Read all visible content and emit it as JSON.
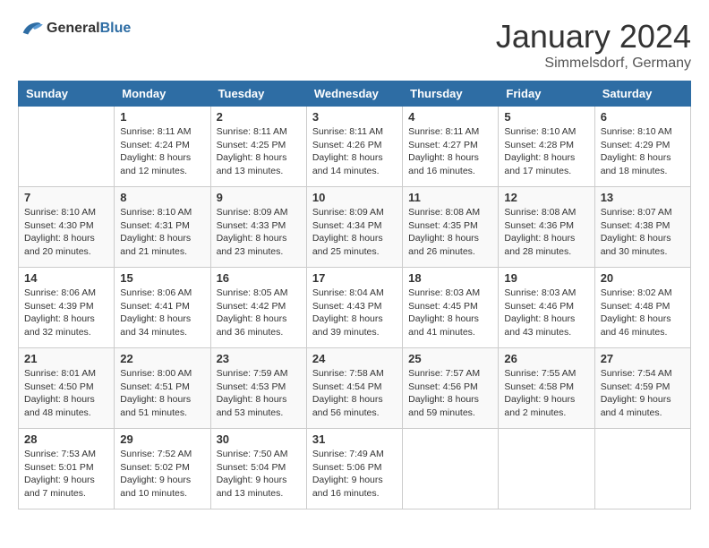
{
  "header": {
    "logo_general": "General",
    "logo_blue": "Blue",
    "title": "January 2024",
    "location": "Simmelsdorf, Germany"
  },
  "days_of_week": [
    "Sunday",
    "Monday",
    "Tuesday",
    "Wednesday",
    "Thursday",
    "Friday",
    "Saturday"
  ],
  "weeks": [
    [
      {
        "num": "",
        "info": ""
      },
      {
        "num": "1",
        "info": "Sunrise: 8:11 AM\nSunset: 4:24 PM\nDaylight: 8 hours\nand 12 minutes."
      },
      {
        "num": "2",
        "info": "Sunrise: 8:11 AM\nSunset: 4:25 PM\nDaylight: 8 hours\nand 13 minutes."
      },
      {
        "num": "3",
        "info": "Sunrise: 8:11 AM\nSunset: 4:26 PM\nDaylight: 8 hours\nand 14 minutes."
      },
      {
        "num": "4",
        "info": "Sunrise: 8:11 AM\nSunset: 4:27 PM\nDaylight: 8 hours\nand 16 minutes."
      },
      {
        "num": "5",
        "info": "Sunrise: 8:10 AM\nSunset: 4:28 PM\nDaylight: 8 hours\nand 17 minutes."
      },
      {
        "num": "6",
        "info": "Sunrise: 8:10 AM\nSunset: 4:29 PM\nDaylight: 8 hours\nand 18 minutes."
      }
    ],
    [
      {
        "num": "7",
        "info": "Sunrise: 8:10 AM\nSunset: 4:30 PM\nDaylight: 8 hours\nand 20 minutes."
      },
      {
        "num": "8",
        "info": "Sunrise: 8:10 AM\nSunset: 4:31 PM\nDaylight: 8 hours\nand 21 minutes."
      },
      {
        "num": "9",
        "info": "Sunrise: 8:09 AM\nSunset: 4:33 PM\nDaylight: 8 hours\nand 23 minutes."
      },
      {
        "num": "10",
        "info": "Sunrise: 8:09 AM\nSunset: 4:34 PM\nDaylight: 8 hours\nand 25 minutes."
      },
      {
        "num": "11",
        "info": "Sunrise: 8:08 AM\nSunset: 4:35 PM\nDaylight: 8 hours\nand 26 minutes."
      },
      {
        "num": "12",
        "info": "Sunrise: 8:08 AM\nSunset: 4:36 PM\nDaylight: 8 hours\nand 28 minutes."
      },
      {
        "num": "13",
        "info": "Sunrise: 8:07 AM\nSunset: 4:38 PM\nDaylight: 8 hours\nand 30 minutes."
      }
    ],
    [
      {
        "num": "14",
        "info": "Sunrise: 8:06 AM\nSunset: 4:39 PM\nDaylight: 8 hours\nand 32 minutes."
      },
      {
        "num": "15",
        "info": "Sunrise: 8:06 AM\nSunset: 4:41 PM\nDaylight: 8 hours\nand 34 minutes."
      },
      {
        "num": "16",
        "info": "Sunrise: 8:05 AM\nSunset: 4:42 PM\nDaylight: 8 hours\nand 36 minutes."
      },
      {
        "num": "17",
        "info": "Sunrise: 8:04 AM\nSunset: 4:43 PM\nDaylight: 8 hours\nand 39 minutes."
      },
      {
        "num": "18",
        "info": "Sunrise: 8:03 AM\nSunset: 4:45 PM\nDaylight: 8 hours\nand 41 minutes."
      },
      {
        "num": "19",
        "info": "Sunrise: 8:03 AM\nSunset: 4:46 PM\nDaylight: 8 hours\nand 43 minutes."
      },
      {
        "num": "20",
        "info": "Sunrise: 8:02 AM\nSunset: 4:48 PM\nDaylight: 8 hours\nand 46 minutes."
      }
    ],
    [
      {
        "num": "21",
        "info": "Sunrise: 8:01 AM\nSunset: 4:50 PM\nDaylight: 8 hours\nand 48 minutes."
      },
      {
        "num": "22",
        "info": "Sunrise: 8:00 AM\nSunset: 4:51 PM\nDaylight: 8 hours\nand 51 minutes."
      },
      {
        "num": "23",
        "info": "Sunrise: 7:59 AM\nSunset: 4:53 PM\nDaylight: 8 hours\nand 53 minutes."
      },
      {
        "num": "24",
        "info": "Sunrise: 7:58 AM\nSunset: 4:54 PM\nDaylight: 8 hours\nand 56 minutes."
      },
      {
        "num": "25",
        "info": "Sunrise: 7:57 AM\nSunset: 4:56 PM\nDaylight: 8 hours\nand 59 minutes."
      },
      {
        "num": "26",
        "info": "Sunrise: 7:55 AM\nSunset: 4:58 PM\nDaylight: 9 hours\nand 2 minutes."
      },
      {
        "num": "27",
        "info": "Sunrise: 7:54 AM\nSunset: 4:59 PM\nDaylight: 9 hours\nand 4 minutes."
      }
    ],
    [
      {
        "num": "28",
        "info": "Sunrise: 7:53 AM\nSunset: 5:01 PM\nDaylight: 9 hours\nand 7 minutes."
      },
      {
        "num": "29",
        "info": "Sunrise: 7:52 AM\nSunset: 5:02 PM\nDaylight: 9 hours\nand 10 minutes."
      },
      {
        "num": "30",
        "info": "Sunrise: 7:50 AM\nSunset: 5:04 PM\nDaylight: 9 hours\nand 13 minutes."
      },
      {
        "num": "31",
        "info": "Sunrise: 7:49 AM\nSunset: 5:06 PM\nDaylight: 9 hours\nand 16 minutes."
      },
      {
        "num": "",
        "info": ""
      },
      {
        "num": "",
        "info": ""
      },
      {
        "num": "",
        "info": ""
      }
    ]
  ]
}
